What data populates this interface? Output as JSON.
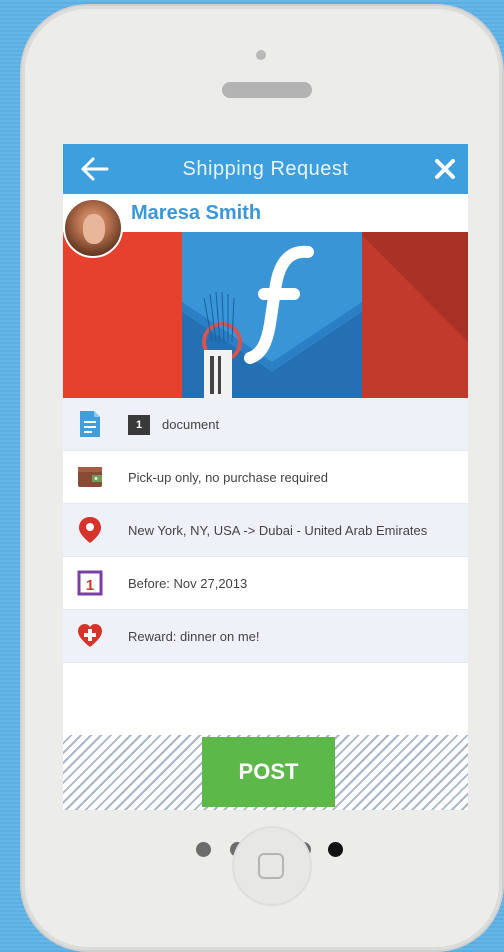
{
  "header": {
    "title": "Shipping Request",
    "back_icon": "arrow-left-icon",
    "close_icon": "close-icon"
  },
  "user": {
    "name": "Maresa Smith",
    "avatar_icon": "user-avatar"
  },
  "colors": {
    "header_bg": "#3d9fdd",
    "hero_bg": "#e6412f",
    "post_bg": "#5cb848",
    "name_color": "#3b98d8"
  },
  "details": [
    {
      "icon": "document-icon",
      "quantity": "1",
      "text": "document"
    },
    {
      "icon": "wallet-icon",
      "text": "Pick-up only, no purchase required"
    },
    {
      "icon": "location-pin-icon",
      "text": "New York, NY, USA -> Dubai - United Arab Emirates"
    },
    {
      "icon": "calendar-icon",
      "text": "Before: Nov 27,2013"
    },
    {
      "icon": "heart-plus-icon",
      "text": "Reward: dinner on me!"
    }
  ],
  "actions": {
    "post_label": "POST"
  },
  "pager": {
    "count": 5,
    "active_index": 4
  }
}
